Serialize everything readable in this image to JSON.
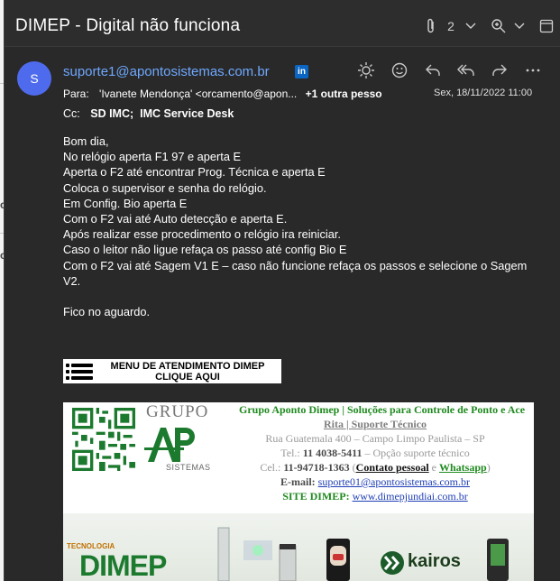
{
  "window": {
    "title": "DIMEP - Digital não funciona",
    "attachment_count": "2",
    "icons": [
      "paperclip-icon",
      "chevron-down-icon",
      "zoom-icon",
      "chevron-down-icon",
      "popout-icon"
    ]
  },
  "message": {
    "avatar_initial": "S",
    "sender": "suporte1@apontosistemas.com.br",
    "to_label": "Para:",
    "to_value": "'Ivanete Mendonça' <orcamento@apon...",
    "to_more": "+1 outra pesso",
    "date": "Sex, 18/11/2022 11:00",
    "cc_label": "Cc:",
    "cc_values": [
      "SD IMC;",
      "IMC Service Desk"
    ],
    "actions": [
      "brightness-icon",
      "emoji-icon",
      "reply-icon",
      "reply-all-icon",
      "forward-icon",
      "more-icon"
    ]
  },
  "body": {
    "greeting": "Bom dia,",
    "lines": [
      "No relógio aperta F1 97 e aperta E",
      "Aperta o F2 até encontrar Prog. Técnica e aperta E",
      "Coloca o supervisor e senha do relógio.",
      "Em Config. Bio aperta E",
      "Com o F2 vai até Auto detecção e aperta E.",
      "Após realizar esse procedimento o relógio ira reiniciar.",
      "Caso o leitor não ligue refaça os passo até config Bio  E",
      "Com o F2 vai até Sagem V1 E – caso não funcione refaça os passos e selecione o Sagem V2."
    ],
    "closing": "Fico no aguardo.",
    "menu_banner_line1": "MENU DE ATENDIMENTO DIMEP",
    "menu_banner_line2": "CLIQUE AQUI"
  },
  "signature": {
    "logo_top": "GRUPO",
    "logo_bottom": "SISTEMAS",
    "company": "Grupo Aponto Dimep | Soluções para Controle de Ponto e Ace",
    "name": "Rita | Suporte Técnico",
    "address": "Rua Guatemala 400 – Campo Limpo Paulista – SP",
    "tel_label": "Tel.:",
    "tel": "11 4038-5411",
    "tel_note": "– Opção suporte técnico",
    "cel_label": "Cel.:",
    "cel": "11-94718-1363",
    "contato": "Contato pessoal",
    "e_word": "e",
    "whatsapp": "Whatsapp",
    "email_label": "E-mail:",
    "email": "suporte01@apontosistemas.com.br",
    "site_label": "SITE DIMEP:",
    "site": "www.dimepjundiai.com.br",
    "tecnologia": "TECNOLOGIA",
    "dimep": "DIMEP",
    "kairos": "kairos"
  },
  "colors": {
    "background": "#292929",
    "link": "#6ea8fe",
    "avatar": "#4f6bed",
    "green": "#1f8a1f"
  }
}
